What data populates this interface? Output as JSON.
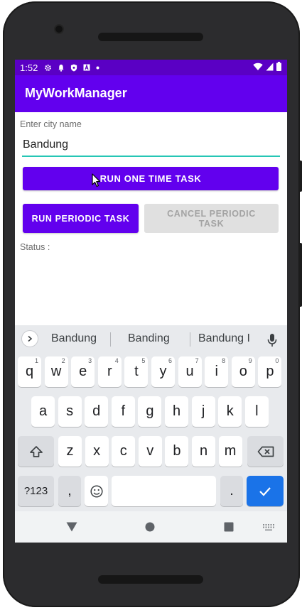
{
  "status_bar": {
    "time": "1:52",
    "icons": [
      "gear-icon",
      "bell-icon",
      "shield-icon",
      "a-icon",
      "dot-icon"
    ],
    "right_icons": [
      "wifi-icon",
      "signal-icon",
      "battery-icon"
    ]
  },
  "app": {
    "title": "MyWorkManager",
    "accent": "#6200ee",
    "status_color": "#5a00c4"
  },
  "form": {
    "city_label": "Enter city name",
    "city_value": "Bandung",
    "run_one_time": "RUN ONE TIME TASK",
    "run_periodic": "RUN PERIODIC TASK",
    "cancel_periodic": "CANCEL PERIODIC TASK",
    "status_label": "Status :"
  },
  "keyboard": {
    "suggestions": [
      "Bandung",
      "Banding",
      "Bandung I"
    ],
    "row1": [
      {
        "k": "q",
        "h": "1"
      },
      {
        "k": "w",
        "h": "2"
      },
      {
        "k": "e",
        "h": "3"
      },
      {
        "k": "r",
        "h": "4"
      },
      {
        "k": "t",
        "h": "5"
      },
      {
        "k": "y",
        "h": "6"
      },
      {
        "k": "u",
        "h": "7"
      },
      {
        "k": "i",
        "h": "8"
      },
      {
        "k": "o",
        "h": "9"
      },
      {
        "k": "p",
        "h": "0"
      }
    ],
    "row2": [
      "a",
      "s",
      "d",
      "f",
      "g",
      "h",
      "j",
      "k",
      "l"
    ],
    "row3": [
      "z",
      "x",
      "c",
      "v",
      "b",
      "n",
      "m"
    ],
    "symbols_label": "?123",
    "comma": ",",
    "period": "."
  },
  "nav": {
    "icons": [
      "back-icon",
      "home-icon",
      "recents-icon",
      "keyboard-switch-icon"
    ]
  }
}
